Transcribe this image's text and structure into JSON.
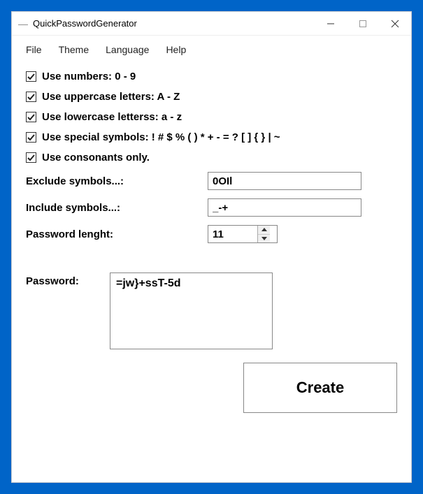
{
  "window": {
    "title": "QuickPasswordGenerator"
  },
  "menu": {
    "file": "File",
    "theme": "Theme",
    "language": "Language",
    "help": "Help"
  },
  "options": {
    "use_numbers": {
      "checked": true,
      "label": "Use numbers: 0 - 9"
    },
    "use_uppercase": {
      "checked": true,
      "label": "Use uppercase letters: A - Z"
    },
    "use_lowercase": {
      "checked": true,
      "label": "Use lowercase letterss: a - z"
    },
    "use_special": {
      "checked": true,
      "label": "Use special symbols: ! # $ % ( ) * + - = ? [ ] { } | ~"
    },
    "use_consonants": {
      "checked": true,
      "label": "Use consonants only."
    }
  },
  "fields": {
    "exclude_label": "Exclude symbols...:",
    "exclude_value": "0OIl",
    "include_label": "Include symbols...:",
    "include_value": "_-+",
    "length_label": "Password lenght:",
    "length_value": "11"
  },
  "output": {
    "password_label": "Password:",
    "password_value": "=jw}+ssT-5d"
  },
  "buttons": {
    "create": "Create"
  }
}
